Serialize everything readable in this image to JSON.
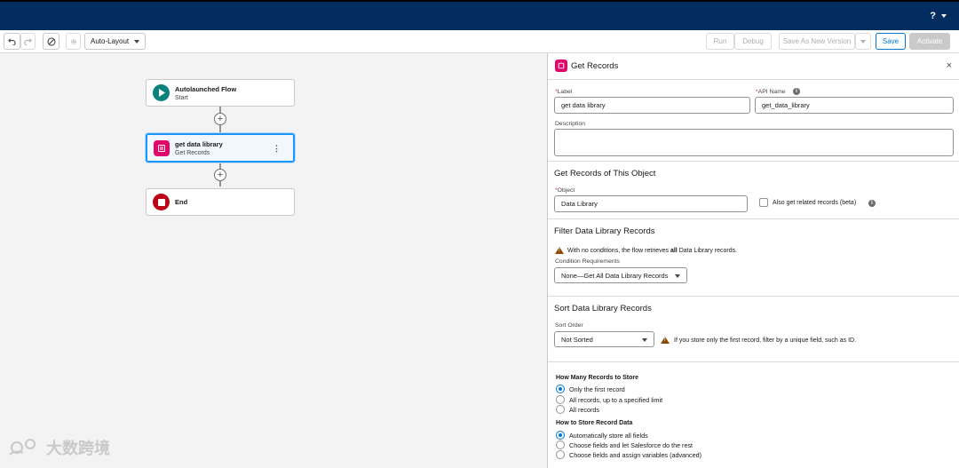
{
  "header": {
    "help_label": "?"
  },
  "toolbar": {
    "layout_select": "Auto-Layout",
    "run": "Run",
    "debug": "Debug",
    "save_as_new_version": "Save As New Version",
    "save": "Save",
    "activate": "Activate"
  },
  "canvas": {
    "start_node": {
      "title": "Autolaunched Flow",
      "subtitle": "Start"
    },
    "get_node": {
      "title": "get data library",
      "subtitle": "Get Records"
    },
    "end_node": {
      "title": "End"
    }
  },
  "panel": {
    "title": "Get Records",
    "label_field": {
      "label": "Label",
      "value": "get data library"
    },
    "api_field": {
      "label": "API Name",
      "value": "get_data_library"
    },
    "description_label": "Description",
    "object_section": {
      "title": "Get Records of This Object",
      "object_label": "Object",
      "object_value": "Data Library",
      "related_label": "Also get related records (beta)"
    },
    "filter_section": {
      "title": "Filter Data Library Records",
      "warning_pre": "With no conditions, the flow retrieves ",
      "warning_bold": "all",
      "warning_post": " Data Library records.",
      "condition_label": "Condition Requirements",
      "condition_value": "None—Get All Data Library Records"
    },
    "sort_section": {
      "title": "Sort Data Library Records",
      "order_label": "Sort Order",
      "order_value": "Not Sorted",
      "warning": "If you store only the first record, filter by a unique field, such as ID."
    },
    "store_section": {
      "how_many_label": "How Many Records to Store",
      "how_many_options": [
        "Only the first record",
        "All records, up to a specified limit",
        "All records"
      ],
      "how_to_label": "How to Store Record Data",
      "how_to_options": [
        "Automatically store all fields",
        "Choose fields and let Salesforce do the rest",
        "Choose fields and assign variables (advanced)"
      ]
    }
  },
  "watermark": {
    "text": "大数跨境"
  },
  "colors": {
    "header": "#032d60",
    "brand_blue": "#0176d3",
    "get_records_pink": "#e3066a",
    "start_teal": "#0b827c",
    "end_red": "#ba0517"
  }
}
